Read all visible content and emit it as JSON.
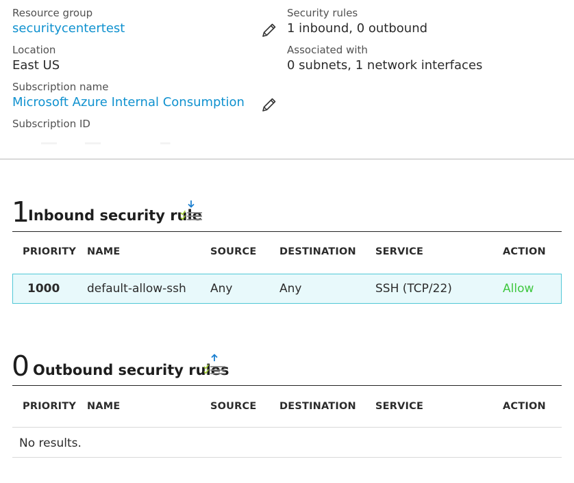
{
  "essentials": {
    "resource_group_label": "Resource group",
    "resource_group_value": "securitycentertest",
    "location_label": "Location",
    "location_value": "East US",
    "subscription_name_label": "Subscription name",
    "subscription_name_value": "Microsoft Azure Internal Consumption",
    "subscription_id_label": "Subscription ID",
    "security_rules_label": "Security rules",
    "security_rules_value": "1 inbound, 0 outbound",
    "associated_label": "Associated with",
    "associated_value": "0 subnets, 1 network interfaces"
  },
  "inbound": {
    "count": "1",
    "title": "Inbound security rule",
    "columns": [
      "PRIORITY",
      "NAME",
      "SOURCE",
      "DESTINATION",
      "SERVICE",
      "ACTION"
    ],
    "rows": [
      {
        "priority": "1000",
        "name": "default-allow-ssh",
        "source": "Any",
        "destination": "Any",
        "service": "SSH (TCP/22)",
        "action": "Allow"
      }
    ]
  },
  "outbound": {
    "count": "0",
    "title": "Outbound security rules",
    "columns": [
      "PRIORITY",
      "NAME",
      "SOURCE",
      "DESTINATION",
      "SERVICE",
      "ACTION"
    ],
    "empty_text": "No results."
  },
  "colors": {
    "link": "#0f91cf",
    "allow": "#3fc73f",
    "selected_row_bg": "#e8f9fb",
    "selected_row_border": "#4fc7d6",
    "sort_arrow": "#1a7fd0",
    "check": "#a6cf38"
  },
  "icons": {
    "edit": "pencil-icon",
    "sort_inbound": "sort-arrow-down-list-icon",
    "sort_outbound": "sort-arrow-up-list-icon"
  }
}
